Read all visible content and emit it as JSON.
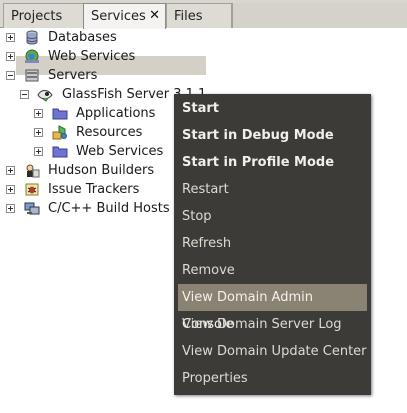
{
  "tabs": [
    {
      "label": "Projects"
    },
    {
      "label": "Services",
      "close": "✕"
    },
    {
      "label": "Files"
    }
  ],
  "tree": {
    "databases": "Databases",
    "web_services": "Web Services",
    "servers": "Servers",
    "glassfish": "GlassFish Server 3.1.1",
    "applications": "Applications",
    "resources": "Resources",
    "server_web_services": "Web Services",
    "hudson": "Hudson Builders",
    "issue_trackers": "Issue Trackers",
    "cpp_hosts": "C/C++ Build Hosts"
  },
  "context_menu": {
    "items": [
      {
        "label": "Start",
        "bold": true
      },
      {
        "label": "Start in Debug Mode",
        "bold": true
      },
      {
        "label": "Start in Profile Mode",
        "bold": true
      },
      {
        "label": "Restart"
      },
      {
        "label": "Stop"
      },
      {
        "label": "Refresh"
      },
      {
        "label": "Remove"
      },
      {
        "label": "View Domain Admin Console",
        "highlighted": true
      },
      {
        "label": "View Domain Server Log"
      },
      {
        "label": "View Domain Update Center"
      },
      {
        "label": "Properties"
      }
    ]
  },
  "colors": {
    "menu_bg": "#3c3b37",
    "menu_highlight": "#8a8272",
    "selection": "#d4d0c8",
    "folder": "#5a5fc4"
  },
  "icons": {
    "databases": "database-icon",
    "web_services": "globe-icon",
    "servers": "server-icon",
    "glassfish": "glassfish-icon",
    "folder": "folder-icon",
    "resources": "resources-icon",
    "hudson": "hudson-icon",
    "issue_trackers": "bug-icon",
    "cpp_hosts": "host-icon"
  }
}
